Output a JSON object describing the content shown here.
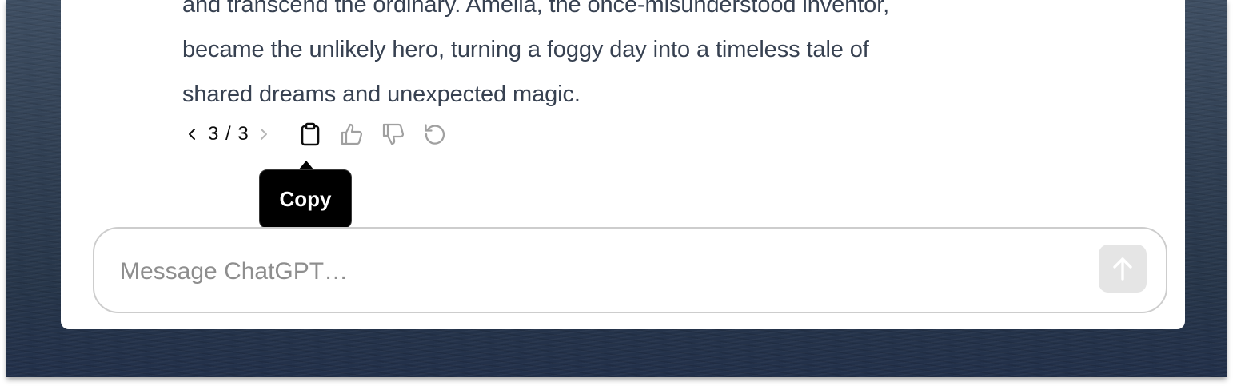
{
  "message": {
    "lines": [
      "and transcend the ordinary. Amelia, the once-misunderstood inventor,",
      "became the unlikely hero, turning a foggy day into a timeless tale of",
      "shared dreams and unexpected magic."
    ]
  },
  "actions": {
    "pager_text": "3 / 3",
    "icons": [
      "chevron-left-icon",
      "chevron-right-icon",
      "clipboard-icon",
      "thumbs-up-icon",
      "thumbs-down-icon",
      "regenerate-icon"
    ]
  },
  "tooltip": {
    "text": "Copy"
  },
  "composer": {
    "placeholder": "Message ChatGPT…",
    "send_icon": "arrow-up-icon"
  },
  "colors": {
    "text": "#374151",
    "icon_muted": "#a0a0a0",
    "tooltip_bg": "#000000",
    "send_disabled": "#e5e5e5"
  }
}
